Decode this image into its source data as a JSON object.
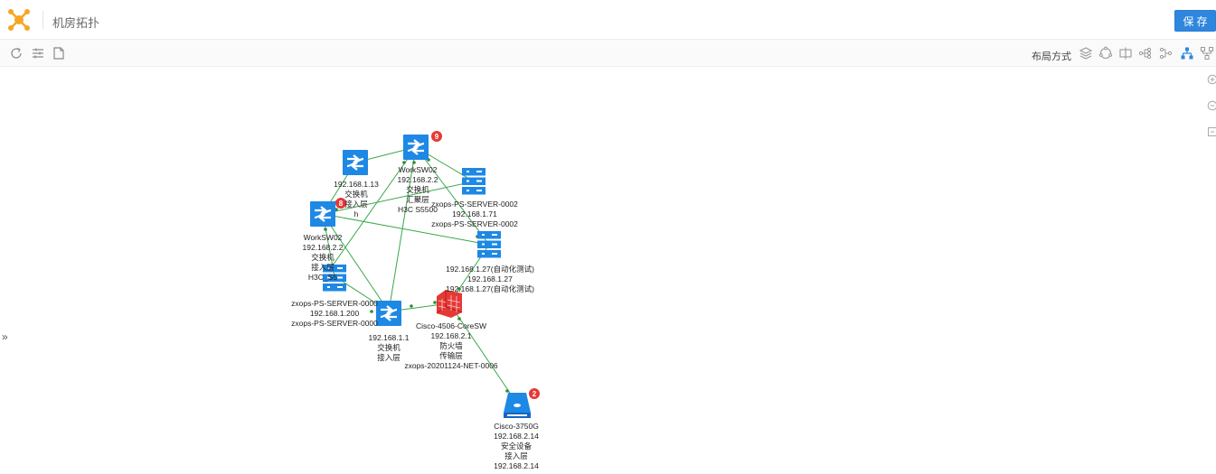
{
  "app": {
    "title": "机房拓扑"
  },
  "header": {
    "save_label": "保存"
  },
  "toolbar": {
    "layout_label": "布局方式"
  },
  "sidebar_toggle": {
    "glyph": "»"
  },
  "colors": {
    "primary": "#2e86de",
    "node_blue": "#1e88e5",
    "link_green": "#3aa84a",
    "alarm_red": "#e53935",
    "firewall_red": "#e53935"
  },
  "nodes": [
    {
      "id": "n1",
      "type": "switch",
      "lines": [
        "192.168.1.13",
        "交换机",
        "接入层",
        "h"
      ]
    },
    {
      "id": "n2",
      "type": "switch",
      "badge": "9",
      "lines": [
        "WorkSW02",
        "192.168.2.2",
        "交换机",
        "汇聚层",
        "H3C S5500"
      ]
    },
    {
      "id": "n3",
      "type": "server",
      "lines": [
        "zxops-PS-SERVER-0002",
        "192.168.1.71",
        "zxops-PS-SERVER-0002"
      ]
    },
    {
      "id": "n4",
      "type": "switch",
      "badge": "8",
      "lines": [
        "WorkSW02",
        "192.168.2.2",
        "交换机",
        "接入层",
        "H3C_S5"
      ]
    },
    {
      "id": "n5",
      "type": "server",
      "lines": [
        "192.168.1.27(自动化测试)",
        "192.168.1.27",
        "192.168.1.27(自动化测试)"
      ]
    },
    {
      "id": "n6",
      "type": "server",
      "lines": [
        "zxops-PS-SERVER-0000",
        "192.168.1.200",
        "zxops-PS-SERVER-0000"
      ]
    },
    {
      "id": "n7",
      "type": "switch",
      "lines": [
        "192.168.1.1",
        "交换机",
        "接入层"
      ]
    },
    {
      "id": "n8",
      "type": "firewall",
      "lines": [
        "Cisco-4506-CoreSW",
        "192.168.2.1",
        "防火墙",
        "传输层",
        "zxops-20201124-NET-0006"
      ]
    },
    {
      "id": "n9",
      "type": "security",
      "badge": "2",
      "lines": [
        "Cisco-3750G",
        "192.168.2.14",
        "安全设备",
        "接入层",
        "192.168.2.14"
      ]
    }
  ],
  "icons": {
    "toolbar_left": [
      "refresh-icon",
      "filter-icon",
      "document-icon"
    ],
    "layout_modes": [
      "layers-icon",
      "circle-layout-icon",
      "split-layout-icon",
      "tree-right-icon",
      "tree-left-icon",
      "hierarchy-icon",
      "network-icon"
    ],
    "side_controls": [
      "zoom-in-icon",
      "zoom-out-icon",
      "fit-icon"
    ]
  }
}
